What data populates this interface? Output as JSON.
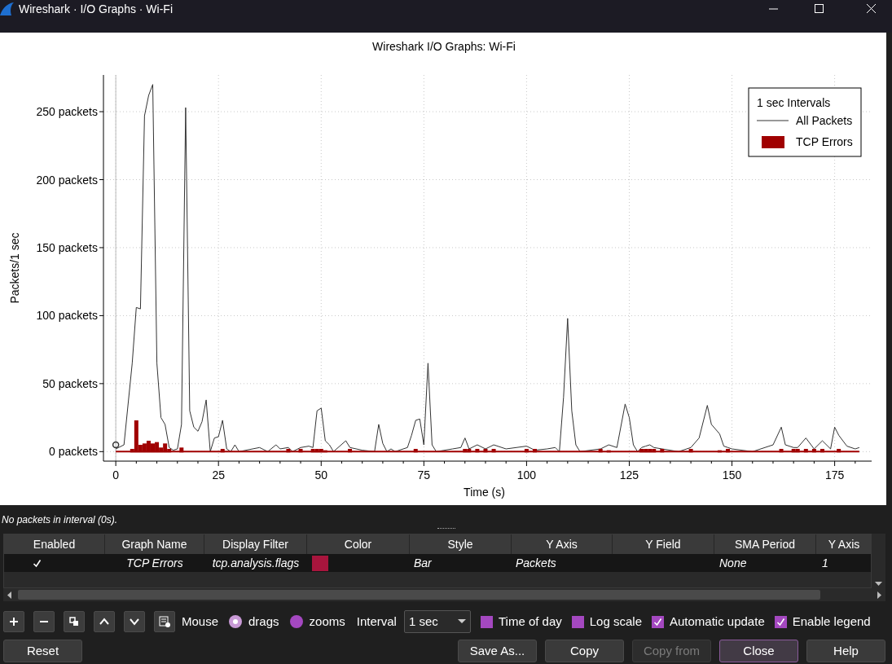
{
  "window": {
    "title": "Wireshark · I/O Graphs · Wi-Fi"
  },
  "chart": {
    "chart_data": {
      "type": "line",
      "title": "Wireshark I/O Graphs: Wi-Fi",
      "xlabel": "Time (s)",
      "ylabel": "Packets/1 sec",
      "x": [
        0,
        2,
        4,
        5,
        6,
        7,
        8,
        9,
        10,
        11,
        12,
        13,
        14,
        15,
        16,
        17,
        18,
        19,
        20,
        21,
        22,
        23,
        24,
        25,
        26,
        27,
        28,
        29,
        30,
        35,
        37,
        39,
        40,
        42,
        43,
        45,
        47,
        48,
        49,
        50,
        51,
        52,
        53,
        56,
        57,
        60,
        63,
        64,
        65,
        66,
        67,
        68,
        71,
        72,
        73,
        74,
        75,
        76,
        77,
        78,
        82,
        84,
        85,
        86,
        88,
        90,
        92,
        95,
        100,
        102,
        105,
        107,
        108,
        109,
        110,
        111,
        112,
        113,
        118,
        120,
        122,
        124,
        125,
        126,
        127,
        128,
        129,
        130,
        131,
        133,
        137,
        140,
        142,
        144,
        145,
        147,
        148,
        149,
        150,
        155,
        160,
        162,
        163,
        165,
        166,
        168,
        170,
        172,
        174,
        175,
        176,
        177,
        178,
        180,
        181
      ],
      "series": [
        {
          "name": "All Packets",
          "color": "#333333",
          "values": [
            2,
            5,
            65,
            106,
            105,
            247,
            262,
            270,
            65,
            25,
            20,
            3,
            1,
            2,
            20,
            253,
            30,
            18,
            15,
            22,
            38,
            0,
            10,
            11,
            23,
            2,
            0,
            5,
            0,
            3,
            0,
            5,
            2,
            3,
            0,
            3,
            4,
            3,
            30,
            32,
            8,
            5,
            0,
            8,
            3,
            1,
            0,
            20,
            6,
            0,
            2,
            0,
            3,
            12,
            23,
            24,
            5,
            65,
            5,
            0,
            2,
            3,
            10,
            2,
            5,
            2,
            5,
            2,
            4,
            1,
            2,
            3,
            0,
            40,
            98,
            30,
            5,
            0,
            2,
            5,
            3,
            35,
            25,
            5,
            0,
            3,
            4,
            5,
            3,
            2,
            0,
            3,
            10,
            34,
            20,
            13,
            4,
            3,
            2,
            0,
            5,
            18,
            5,
            3,
            3,
            10,
            2,
            8,
            2,
            18,
            12,
            8,
            4,
            2,
            3
          ]
        }
      ],
      "xlim": [
        -3,
        184
      ],
      "ylim": [
        -7,
        277
      ],
      "grid": true,
      "legend": "upper right",
      "xticks": [
        0,
        25,
        50,
        75,
        100,
        125,
        150,
        175
      ],
      "yticks": [
        {
          "value": 0,
          "label": "0 packets"
        },
        {
          "value": 50,
          "label": "50 packets"
        },
        {
          "value": 100,
          "label": "100 packets"
        },
        {
          "value": 150,
          "label": "150 packets"
        },
        {
          "value": 200,
          "label": "200 packets"
        },
        {
          "value": 250,
          "label": "250 packets"
        }
      ]
    },
    "legend_title": "1 sec Intervals"
  },
  "error_bars": {
    "chart_data": {
      "type": "bar",
      "x": [
        4,
        5,
        6,
        7,
        8,
        9,
        10,
        11,
        12,
        13,
        16,
        26,
        42,
        45,
        48,
        49,
        50,
        51,
        57,
        73,
        85,
        86,
        88,
        90,
        92,
        100,
        102,
        118,
        120,
        128,
        129,
        130,
        131,
        133,
        140,
        147,
        149,
        162,
        165,
        166,
        168,
        170,
        172,
        176
      ],
      "series": [
        {
          "name": "TCP Errors",
          "color": "#a00000",
          "values": [
            2,
            23,
            5,
            6,
            8,
            6,
            7,
            3,
            6,
            2,
            3,
            2,
            2,
            2,
            2,
            2,
            2,
            1,
            2,
            2,
            2,
            2,
            2,
            2,
            2,
            2,
            2,
            2,
            1,
            2,
            2,
            2,
            2,
            2,
            2,
            1,
            2,
            2,
            2,
            2,
            2,
            2,
            2,
            2
          ]
        }
      ],
      "xlim": [
        -3,
        184
      ],
      "ylim": [
        -7,
        277
      ]
    }
  },
  "status": "No packets in interval (0s).",
  "table": {
    "columns": [
      "Enabled",
      "Graph Name",
      "Display Filter",
      "Color",
      "Style",
      "Y Axis",
      "Y Field",
      "SMA Period",
      "Y Axis"
    ],
    "rows": [
      {
        "cells": [
          {
            "kind": "checkbox",
            "checked": true
          },
          {
            "kind": "text",
            "text": "TCP Errors"
          },
          {
            "kind": "text",
            "text": "tcp.analysis.flags"
          },
          {
            "kind": "color",
            "color": "#a8153d"
          },
          {
            "kind": "text",
            "text": "Bar"
          },
          {
            "kind": "text",
            "text": "Packets"
          },
          {
            "kind": "empty"
          },
          {
            "kind": "text",
            "text": "None"
          },
          {
            "kind": "text",
            "text": "1"
          }
        ]
      }
    ]
  },
  "mouse": {
    "label": "Mouse",
    "options": [
      {
        "label": "drags",
        "selected": true
      },
      {
        "label": "zooms",
        "selected": false
      }
    ]
  },
  "interval": {
    "label": "Interval",
    "value": "1 sec"
  },
  "checkboxes": [
    {
      "label": "Time of day",
      "checked": false
    },
    {
      "label": "Log scale",
      "checked": false
    },
    {
      "label": "Automatic update",
      "checked": true
    },
    {
      "label": "Enable legend",
      "checked": true
    }
  ],
  "left_buttons": [
    {
      "label": "Reset",
      "disabled": false,
      "focused": false
    }
  ],
  "right_buttons": [
    {
      "label": "Save As...",
      "disabled": false,
      "focused": false
    },
    {
      "label": "Copy",
      "disabled": false,
      "focused": false
    },
    {
      "label": "Copy from",
      "disabled": true,
      "focused": false
    },
    {
      "label": "Close",
      "disabled": false,
      "focused": true
    },
    {
      "label": "Help",
      "disabled": false,
      "focused": false
    }
  ]
}
